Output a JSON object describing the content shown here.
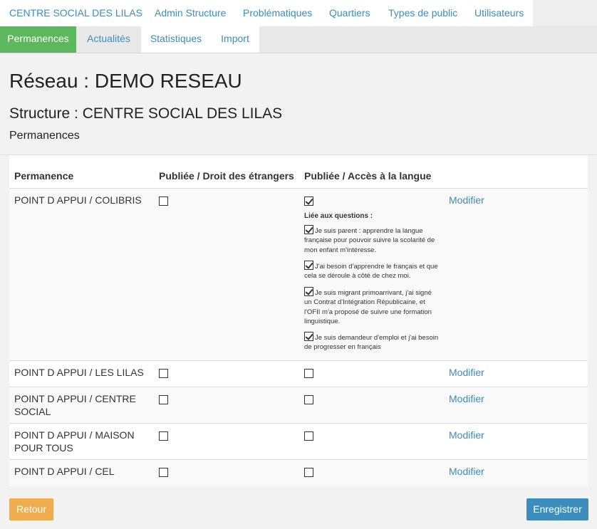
{
  "nav": {
    "top": [
      "CENTRE SOCIAL DES LILAS",
      "Admin Structure",
      "Problématiques",
      "Quartiers",
      "Types de public",
      "Utilisateurs"
    ],
    "tabs": [
      "Permanences",
      "Actualités",
      "Statistiques",
      "Import"
    ],
    "active_tab": "Permanences"
  },
  "header": {
    "title": "Réseau : DEMO RESEAU",
    "structure": "Structure : CENTRE SOCIAL DES LILAS",
    "subtitle": "Permanences"
  },
  "table": {
    "columns": [
      "Permanence",
      "Publiée / Droit des étrangers",
      "Publiée / Accès à la langue"
    ],
    "modify_label": "Modifier",
    "linked_label": "Liée aux questions :",
    "rows": [
      {
        "name": "POINT D APPUI / COLIBRIS",
        "droit": false,
        "langue": true,
        "questions": [
          {
            "checked": true,
            "text": "Je suis parent : apprendre la langue française pour pouvoir suivre la scolarité de mon enfant m'intéresse."
          },
          {
            "checked": true,
            "text": "J'ai besoin d'apprendre le français et que cela se déroule à côté de chez moi."
          },
          {
            "checked": true,
            "text": "Je suis migrant primoarrivant, j'ai signé un Contrat d'Intégration Républicaine, et l'OFII m'a proposé de suivre une formation linguistique."
          },
          {
            "checked": true,
            "text": "Je suis demandeur d'emploi et j'ai besoin de progresser en français"
          }
        ]
      },
      {
        "name": "POINT D APPUI / LES LILAS",
        "droit": false,
        "langue": false
      },
      {
        "name": "POINT D APPUI / CENTRE SOCIAL",
        "droit": false,
        "langue": false
      },
      {
        "name": "POINT D APPUI / MAISON POUR TOUS",
        "droit": false,
        "langue": false
      },
      {
        "name": "POINT D APPUI / CEL",
        "droit": false,
        "langue": false
      }
    ]
  },
  "buttons": {
    "back": "Retour",
    "save": "Enregistrer"
  },
  "colors": {
    "link": "#3c8dbc",
    "active_tab": "#5cb85c",
    "warning": "#f0ad4e",
    "primary": "#3c8dbc"
  }
}
